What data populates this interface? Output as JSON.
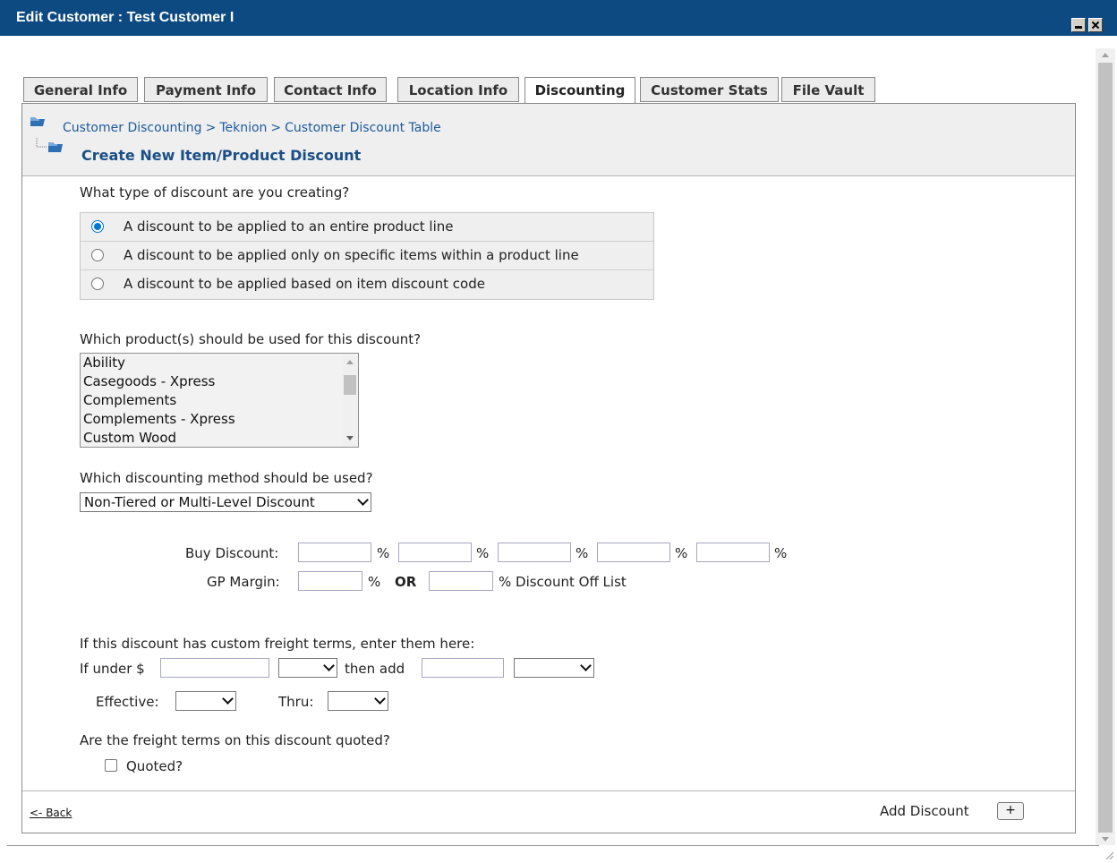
{
  "window": {
    "title": "Edit Customer : Test Customer I"
  },
  "tabs": [
    {
      "label": "General Info"
    },
    {
      "label": "Payment Info"
    },
    {
      "label": "Contact Info"
    },
    {
      "label": "Location Info"
    },
    {
      "label": "Discounting"
    },
    {
      "label": "Customer Stats"
    },
    {
      "label": "File Vault"
    }
  ],
  "active_tab": "Discounting",
  "breadcrumb": {
    "items": [
      "Customer Discounting",
      "Teknion",
      "Customer Discount Table"
    ],
    "separator": ">",
    "subheading": "Create New Item/Product Discount"
  },
  "discount_type": {
    "question": "What type of discount are you creating?",
    "options": [
      {
        "label": "A discount to be applied to an entire product line",
        "selected": true
      },
      {
        "label": "A discount to be applied only on specific items within a product line",
        "selected": false
      },
      {
        "label": "A discount to be applied based on item discount code",
        "selected": false
      }
    ]
  },
  "products": {
    "question": "Which product(s) should be used for this discount?",
    "items": [
      "Ability",
      "Casegoods - Xpress",
      "Complements",
      "Complements - Xpress",
      "Custom Wood"
    ]
  },
  "method": {
    "question": "Which discounting method should be used?",
    "selected": "Non-Tiered or Multi-Level Discount"
  },
  "pricing": {
    "buy_discount_label": "Buy Discount:",
    "percent": "%",
    "gp_margin_label": "GP Margin:",
    "or": "OR",
    "discount_off_list": "% Discount Off List"
  },
  "freight": {
    "question": "If this discount has custom freight terms, enter them here:",
    "if_under": "If under $",
    "then_add": "then add",
    "effective": "Effective:",
    "thru": "Thru:"
  },
  "quoted": {
    "question": "Are the freight terms on this discount quoted?",
    "checkbox_label": "Quoted?",
    "checked": false
  },
  "footer": {
    "back": "<- Back",
    "add_discount": "Add Discount",
    "add_button": "+"
  },
  "colors": {
    "title_bar": "#0d4a82",
    "link": "#1e5a9a",
    "radio_accent": "#0078d4"
  }
}
